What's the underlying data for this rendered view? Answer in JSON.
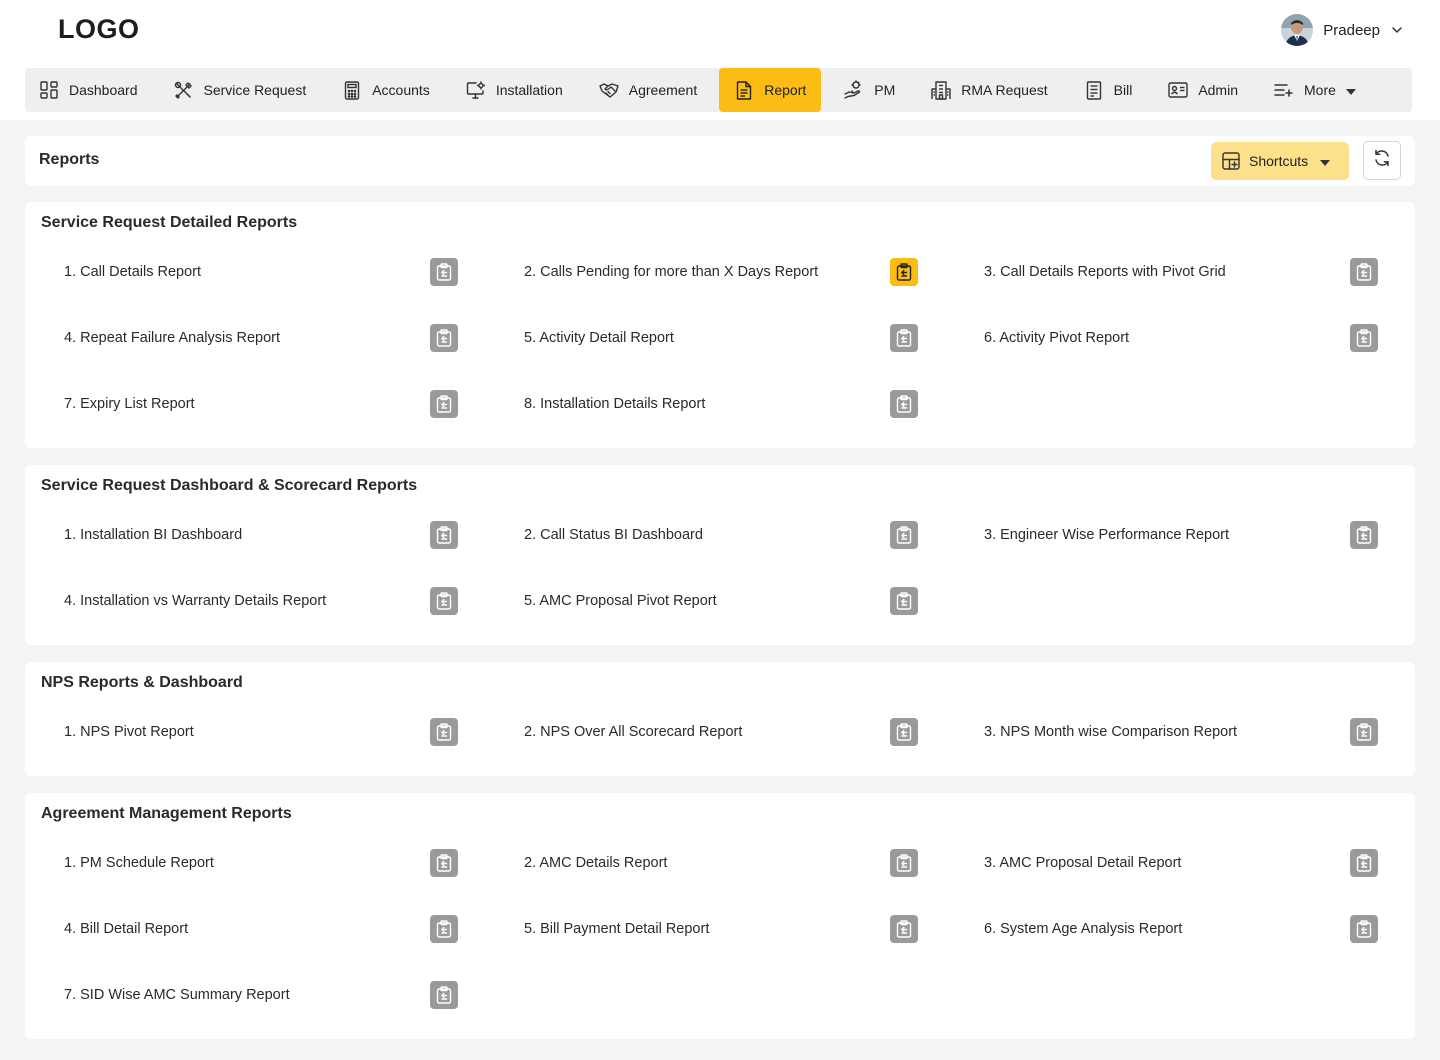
{
  "header": {
    "logo": "LOGO",
    "user_name": "Pradeep"
  },
  "nav": [
    {
      "label": "Dashboard",
      "icon": "dashboard-grid-icon"
    },
    {
      "label": "Service Request",
      "icon": "tools-icon"
    },
    {
      "label": "Accounts",
      "icon": "calculator-icon"
    },
    {
      "label": "Installation",
      "icon": "monitor-settings-icon"
    },
    {
      "label": "Agreement",
      "icon": "handshake-icon"
    },
    {
      "label": "Report",
      "icon": "report-document-icon",
      "active": true
    },
    {
      "label": "PM",
      "icon": "hand-service-icon"
    },
    {
      "label": "RMA Request",
      "icon": "building-icon"
    },
    {
      "label": "Bill",
      "icon": "bill-document-icon"
    },
    {
      "label": "Admin",
      "icon": "id-card-icon"
    },
    {
      "label": "More",
      "icon": "list-add-icon"
    }
  ],
  "page": {
    "title": "Reports",
    "shortcuts_label": "Shortcuts"
  },
  "colors": {
    "accent": "#fbbd14",
    "accent_light": "#fde08a",
    "icon_button": "#9a9a9a"
  },
  "sections": [
    {
      "title": "Service Request Detailed Reports",
      "items": [
        "1. Call Details Report",
        "2. Calls Pending for more than X Days Report",
        "3. Call Details Reports with Pivot Grid",
        "4. Repeat Failure Analysis Report",
        "5. Activity Detail Report",
        "6. Activity Pivot Report",
        "7. Expiry List Report",
        "8. Installation Details Report"
      ],
      "highlighted_index": 1
    },
    {
      "title": "Service Request Dashboard & Scorecard Reports",
      "items": [
        "1. Installation BI Dashboard",
        "2. Call Status BI Dashboard",
        "3. Engineer Wise Performance Report",
        "4. Installation vs Warranty Details Report",
        "5. AMC Proposal Pivot Report"
      ]
    },
    {
      "title": "NPS Reports & Dashboard",
      "items": [
        "1. NPS Pivot Report",
        "2. NPS Over All Scorecard Report",
        "3. NPS Month wise Comparison Report"
      ]
    },
    {
      "title": "Agreement Management Reports",
      "items": [
        "1. PM Schedule Report",
        "2. AMC Details Report",
        "3. AMC Proposal Detail Report",
        "4. Bill Detail Report",
        "5. Bill Payment Detail Report",
        "6. System Age Analysis Report",
        "7. SID Wise AMC Summary Report"
      ]
    }
  ]
}
